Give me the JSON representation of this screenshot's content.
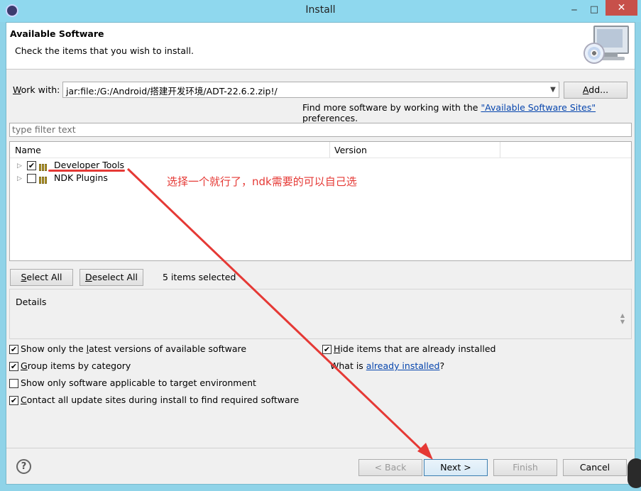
{
  "window": {
    "title": "Install",
    "minimize": "‒",
    "maximize": "□",
    "close": "✕"
  },
  "header": {
    "title": "Available Software",
    "description": "Check the items that you wish to install."
  },
  "work_with": {
    "label_underlined": "W",
    "label_rest": "ork with:",
    "value": "jar:file:/G:/Android/搭建开发环境/ADT-22.6.2.zip!/",
    "add_underlined": "A",
    "add_rest": "dd..."
  },
  "find_more": {
    "prefix": "Find more software by working with the ",
    "link": "\"Available Software Sites\"",
    "suffix": " preferences."
  },
  "filter": {
    "placeholder": "type filter text"
  },
  "tree": {
    "columns": [
      "Name",
      "Version"
    ],
    "items": [
      {
        "label": "Developer Tools",
        "checked": true,
        "version": ""
      },
      {
        "label": "NDK Plugins",
        "checked": false,
        "version": ""
      }
    ]
  },
  "annotation": "选择一个就行了，ndk需要的可以自己选",
  "selection": {
    "select_all_underlined": "S",
    "select_all_rest": "elect All",
    "deselect_all_underlined": "D",
    "deselect_all_rest": "eselect All",
    "count": "5 items selected"
  },
  "details": {
    "label": "Details"
  },
  "options": {
    "latest": {
      "pre": "Show only the ",
      "u": "l",
      "post": "atest versions of available software",
      "checked": true
    },
    "group": {
      "pre": "",
      "u": "G",
      "post": "roup items by category",
      "checked": true
    },
    "applicable": {
      "pre": "Show only software applicable to target environment",
      "u": "",
      "post": "",
      "checked": false
    },
    "contact": {
      "pre": "",
      "u": "C",
      "post": "ontact all update sites during install to find required software",
      "checked": true
    },
    "hide": {
      "pre": "",
      "u": "H",
      "post": "ide items that are already installed",
      "checked": true
    },
    "what_is_prefix": "What is ",
    "what_is_link": "already installed",
    "what_is_suffix": "?"
  },
  "buttons": {
    "help": "?",
    "back": "< Back",
    "next": "Next >",
    "finish": "Finish",
    "cancel": "Cancel"
  }
}
